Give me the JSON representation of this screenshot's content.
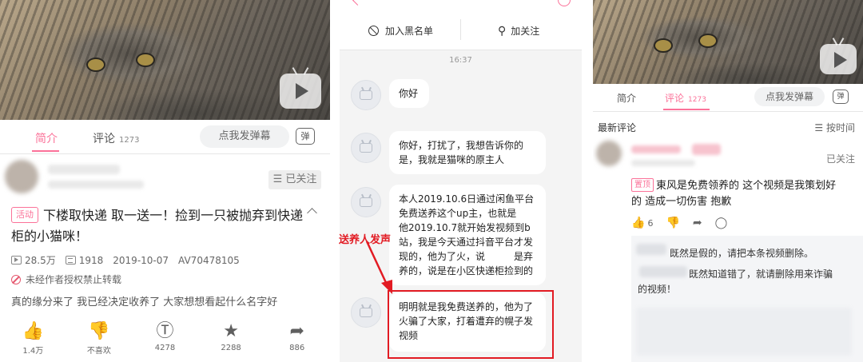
{
  "colors": {
    "accent": "#fb7299",
    "annotation_red": "#e21b23"
  },
  "left_panel": {
    "tabs": [
      {
        "label": "简介"
      },
      {
        "label": "评论",
        "count": "1273"
      }
    ],
    "danmu_placeholder": "点我发弹幕",
    "danmu_icon": "弹",
    "follow_label": "☰ 已关注",
    "activity_tag": "活动",
    "title": "下楼取快递  取一送一！捡到一只被抛弃到快递柜的小猫咪！",
    "collapse_icon": "chevron-up-icon",
    "stats": {
      "plays": "28.5万",
      "danmaku": "1918",
      "date": "2019-10-07",
      "av": "AV70478105"
    },
    "notice": "未经作者授权禁止转载",
    "description": "真的缘分来了 我已经决定收养了 大家想想看起什么名字好",
    "actions": [
      {
        "icon": "thumb-up-icon",
        "label": "1.4万"
      },
      {
        "icon": "thumb-down-icon",
        "label": "不喜欢"
      },
      {
        "icon": "coin-icon",
        "label": "4278"
      },
      {
        "icon": "star-icon",
        "label": "2288"
      },
      {
        "icon": "share-icon",
        "label": "886"
      }
    ]
  },
  "middle_panel": {
    "blacklist_label": "加入黑名单",
    "follow_label": "加关注",
    "time": "16:37",
    "messages": [
      {
        "text": "你好"
      },
      {
        "text": "你好，打扰了，我想告诉你的是，我就是猫咪的原主人"
      },
      {
        "text": "本人2019.10.6日通过闲鱼平台免费送养这个up主，也就是　　　他2019.10.7就开始发视频到b站，我是今天通过抖音平台才发现的，他为了火，说　　　是弃养的，说是在小区快递柜捡到的"
      },
      {
        "text": "明明就是我免费送养的，他为了火骗了大家，打着遭弃的幌子发视频"
      }
    ],
    "annotation": "送养人发声"
  },
  "right_panel": {
    "tabs": [
      {
        "label": "简介"
      },
      {
        "label": "评论",
        "count": "1273"
      }
    ],
    "danmu_placeholder": "点我发弹幕",
    "danmu_icon": "弹",
    "latest_label": "最新评论",
    "sort_label": "☰ 按时间",
    "follow_status": "已关注",
    "pin_tag": "置顶",
    "pinned_comment": "東风是免费领养的 这个视频是我策划好的 造成一切伤害 抱歉",
    "like_count": "6",
    "replies": [
      "既然是假的，请把本条视频删除。",
      "既然知道错了，就请删除用来诈骗",
      "的视频！"
    ]
  }
}
